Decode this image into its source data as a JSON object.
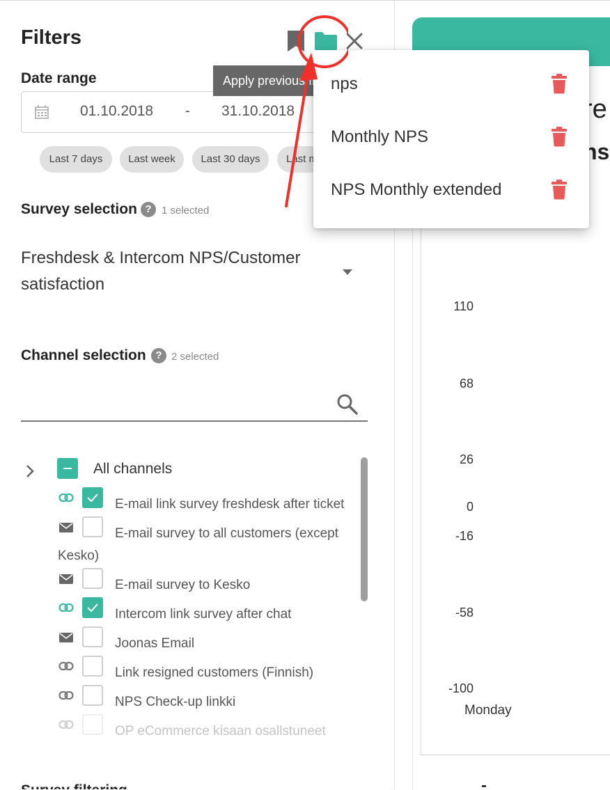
{
  "filters": {
    "title": "Filters",
    "date_range_label": "Date range",
    "date_start": "01.10.2018",
    "date_sep": "-",
    "date_end": "31.10.2018",
    "chips": [
      "Last 7 days",
      "Last week",
      "Last 30 days",
      "Last m"
    ],
    "survey_label": "Survey selection",
    "survey_count": "1 selected",
    "survey_value": "Freshdesk & Intercom NPS/Customer satisfaction",
    "channel_label": "Channel selection",
    "channel_count": "2 selected",
    "all_channels": "All channels",
    "channels": [
      {
        "name": "E-mail link survey freshdesk after ticket",
        "icon": "link-icon",
        "checked": true
      },
      {
        "name": "E-mail survey to all customers (except",
        "cont": "Kesko)",
        "icon": "mail-icon",
        "checked": false
      },
      {
        "name": "E-mail survey to Kesko",
        "icon": "mail-icon",
        "checked": false
      },
      {
        "name": "Intercom link survey after chat",
        "icon": "link-icon",
        "checked": true
      },
      {
        "name": "Joonas Email",
        "icon": "mail-icon",
        "checked": false
      },
      {
        "name": "Link resigned customers (Finnish)",
        "icon": "link-icon",
        "checked": false
      },
      {
        "name": "NPS Check-up linkki",
        "icon": "link-icon",
        "checked": false
      },
      {
        "name": "OP eCommerce kisaan osallstuneet",
        "icon": "link-icon",
        "checked": false
      }
    ],
    "bottom_label": "Survey filtering"
  },
  "tooltip": "Apply previous filters",
  "saved_filters_menu": {
    "items": [
      "nps",
      "Monthly NPS",
      "NPS Monthly extended"
    ]
  },
  "right_panel": {
    "fragment_1": "re",
    "fragment_2": "ns",
    "y_ticks": [
      "110",
      "68",
      "26",
      "0",
      "-16",
      "-58",
      "-100"
    ],
    "x_label": "Monday"
  },
  "colors": {
    "accent": "#3ab9a0",
    "delete": "#e85a5a",
    "annotation": "#f0302a"
  }
}
